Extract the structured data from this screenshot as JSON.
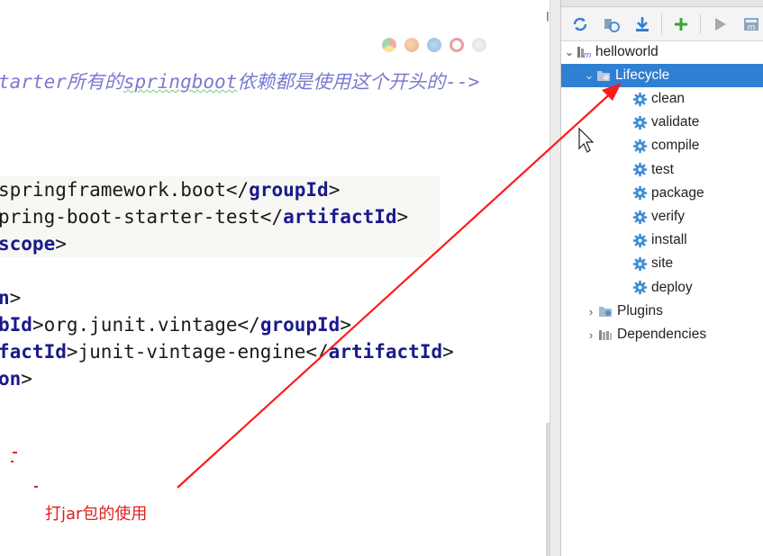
{
  "editor": {
    "comment_prefix": "tarter",
    "comment_mid": "所有的",
    "comment_word": "springboot",
    "comment_suffix": "依赖都是使用这个开头的-->",
    "lines": [
      {
        "pre": "springframework.boot",
        "tag_open": "</",
        "tag": "groupId",
        "tag_close": ">",
        "head": ""
      },
      {
        "pre": "pring-boot-starter-test",
        "tag_open": "</",
        "tag": "artifactId",
        "tag_close": ">",
        "head": ""
      },
      {
        "head": "scope",
        "close": ">"
      },
      {
        "head": "n",
        "close": ">"
      },
      {
        "head": "bId",
        "mid": ">org.junit.vintage",
        "tag_open": "</",
        "tag": "groupId",
        "tag_close": ">"
      },
      {
        "head": "factId",
        "mid": ">junit-vintage-engine",
        "tag_open": "</",
        "tag": "artifactId",
        "tag_close": ">"
      },
      {
        "head": "on",
        "close": ">"
      }
    ]
  },
  "annotation": {
    "text": "打jar包的使用",
    "color": "#e02020"
  },
  "maven": {
    "toolbar": [
      {
        "icon": "reimport-icon",
        "color": "#2f7fd3"
      },
      {
        "icon": "generate-sources-icon",
        "color": "#4a8fd8"
      },
      {
        "icon": "download-icon",
        "color": "#2f7fd3"
      },
      {
        "icon": "add-icon",
        "color": "#3aa53a"
      },
      {
        "icon": "run-icon",
        "color": "#9a9a9a"
      },
      {
        "icon": "execute-goal-icon",
        "color": "#6a8fb8"
      }
    ],
    "project": "helloworld",
    "lifecycle": "Lifecycle",
    "goals": [
      "clean",
      "validate",
      "compile",
      "test",
      "package",
      "verify",
      "install",
      "site",
      "deploy"
    ],
    "plugins": "Plugins",
    "dependencies": "Dependencies",
    "selected_color": "#2f7fd3"
  }
}
